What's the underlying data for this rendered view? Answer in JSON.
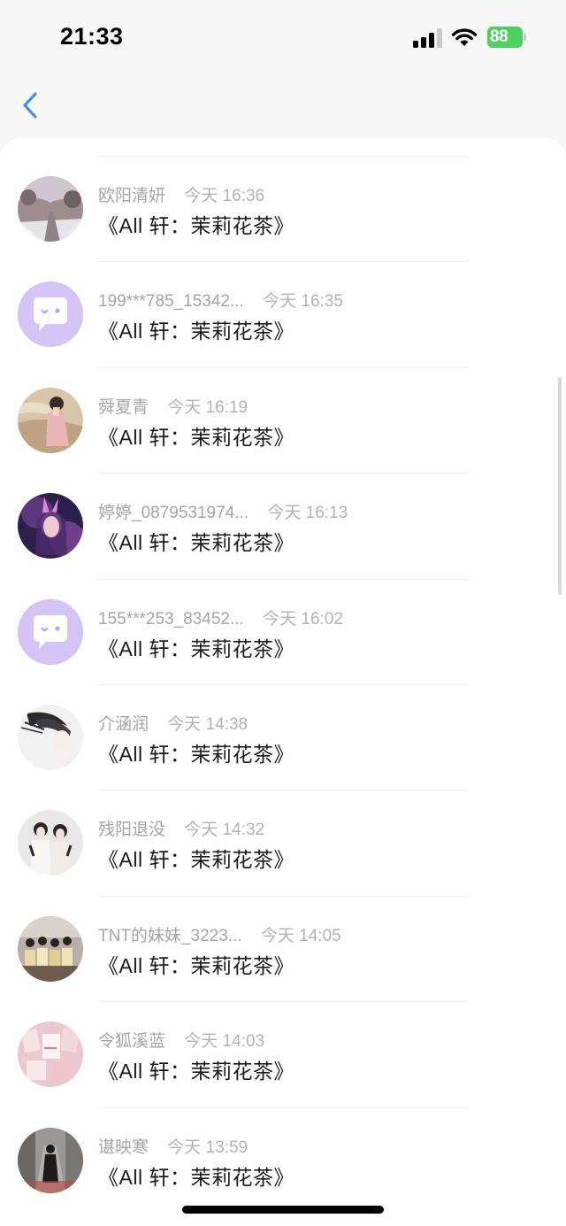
{
  "status_bar": {
    "time": "21:33",
    "battery_level": "88",
    "battery_color": "#4cd15e"
  },
  "nav": {
    "back_icon": "chevron-left-icon",
    "accent_color": "#3d8ff0"
  },
  "list": {
    "items": [
      {
        "name": "欧阳清妍",
        "time": "今天 16:36",
        "message": "《All 轩：茉莉花茶》",
        "avatar": "photo"
      },
      {
        "name": "199***785_15342...",
        "time": "今天 16:35",
        "message": "《All 轩：茉莉花茶》",
        "avatar": "default"
      },
      {
        "name": "舜夏青",
        "time": "今天 16:19",
        "message": "《All 轩：茉莉花茶》",
        "avatar": "photo"
      },
      {
        "name": "婷婷_0879531974...",
        "time": "今天 16:13",
        "message": "《All 轩：茉莉花茶》",
        "avatar": "photo"
      },
      {
        "name": "155***253_83452...",
        "time": "今天 16:02",
        "message": "《All 轩：茉莉花茶》",
        "avatar": "default"
      },
      {
        "name": "介涵润",
        "time": "今天 14:38",
        "message": "《All 轩：茉莉花茶》",
        "avatar": "photo"
      },
      {
        "name": "残阳退没",
        "time": "今天 14:32",
        "message": "《All 轩：茉莉花茶》",
        "avatar": "photo"
      },
      {
        "name": "TNT的妹妹_3223...",
        "time": "今天 14:05",
        "message": "《All 轩：茉莉花茶》",
        "avatar": "photo"
      },
      {
        "name": "令狐溪蓝",
        "time": "今天 14:03",
        "message": "《All 轩：茉莉花茶》",
        "avatar": "photo"
      },
      {
        "name": "谌映寒",
        "time": "今天 13:59",
        "message": "《All 轩：茉莉花茶》",
        "avatar": "photo"
      }
    ]
  }
}
